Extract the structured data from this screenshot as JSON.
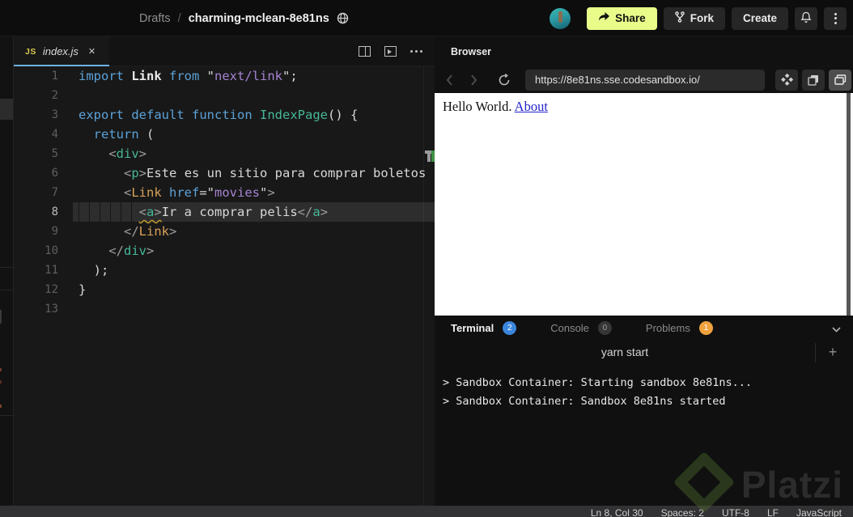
{
  "header": {
    "breadcrumb": {
      "section": "Drafts",
      "separator": "/",
      "project": "charming-mclean-8e81ns"
    },
    "share_label": "Share",
    "fork_label": "Fork",
    "create_label": "Create"
  },
  "colors": {
    "share_button": "#e9fc8a",
    "tab_underline": "#6fb2e2",
    "terminal_badge": "#3b86dd",
    "problems_badge": "#efa23d",
    "browser_link": "#2222cc",
    "keyword": "#5ca2d8",
    "string": "#a583d2",
    "tag": "#46b798",
    "component": "#d7a158"
  },
  "editor": {
    "tab": {
      "icon": "JS",
      "label": "index.js",
      "close": "✕"
    },
    "lines": [
      {
        "n": "1",
        "seg": [
          [
            "k",
            "import"
          ],
          [
            "w",
            " "
          ],
          [
            "b",
            "Link"
          ],
          [
            "w",
            " "
          ],
          [
            "k",
            "from"
          ],
          [
            "w",
            " \""
          ],
          [
            "s",
            "next/link"
          ],
          [
            "w",
            "\";"
          ]
        ]
      },
      {
        "n": "2",
        "seg": []
      },
      {
        "n": "3",
        "seg": [
          [
            "k",
            "export"
          ],
          [
            "w",
            " "
          ],
          [
            "k",
            "default"
          ],
          [
            "w",
            " "
          ],
          [
            "k",
            "function"
          ],
          [
            "w",
            " "
          ],
          [
            "t",
            "IndexPage"
          ],
          [
            "w",
            "() {"
          ]
        ]
      },
      {
        "n": "4",
        "seg": [
          [
            "w",
            "  "
          ],
          [
            "k",
            "return"
          ],
          [
            "w",
            " ("
          ]
        ]
      },
      {
        "n": "5",
        "seg": [
          [
            "w",
            "    "
          ],
          [
            "p",
            "<"
          ],
          [
            "t",
            "div"
          ],
          [
            "p",
            ">"
          ]
        ]
      },
      {
        "n": "6",
        "seg": [
          [
            "w",
            "      "
          ],
          [
            "p",
            "<"
          ],
          [
            "t",
            "p"
          ],
          [
            "p",
            ">"
          ],
          [
            "w",
            "Este es un sitio para comprar boletos"
          ]
        ]
      },
      {
        "n": "7",
        "seg": [
          [
            "w",
            "      "
          ],
          [
            "p",
            "<"
          ],
          [
            "c",
            "Link"
          ],
          [
            "w",
            " "
          ],
          [
            "a",
            "href"
          ],
          [
            "w",
            "=\""
          ],
          [
            "s",
            "movies"
          ],
          [
            "w",
            "\""
          ],
          [
            "p",
            ">"
          ]
        ]
      },
      {
        "n": "8",
        "hl": true,
        "seg": [
          [
            "w",
            "        "
          ],
          [
            "p sq",
            "<"
          ],
          [
            "t sq",
            "a"
          ],
          [
            "p sq",
            ">"
          ],
          [
            "w",
            "Ir a comprar pelis"
          ],
          [
            "p",
            "</"
          ],
          [
            "t",
            "a"
          ],
          [
            "p",
            ">"
          ]
        ]
      },
      {
        "n": "9",
        "seg": [
          [
            "w",
            "      "
          ],
          [
            "p",
            "</"
          ],
          [
            "c",
            "Link"
          ],
          [
            "p",
            ">"
          ]
        ]
      },
      {
        "n": "10",
        "seg": [
          [
            "w",
            "    "
          ],
          [
            "p",
            "</"
          ],
          [
            "t",
            "div"
          ],
          [
            "p",
            ">"
          ]
        ]
      },
      {
        "n": "11",
        "seg": [
          [
            "w",
            "  );"
          ]
        ]
      },
      {
        "n": "12",
        "seg": [
          [
            "w",
            "}"
          ]
        ]
      },
      {
        "n": "13",
        "seg": []
      }
    ]
  },
  "browser": {
    "title": "Browser",
    "url": "https://8e81ns.sse.codesandbox.io/",
    "content": {
      "text": "Hello World. ",
      "link": "About"
    }
  },
  "terminal": {
    "tabs": [
      {
        "label": "Terminal",
        "badge": "2"
      },
      {
        "label": "Console",
        "badge": "0"
      },
      {
        "label": "Problems",
        "badge": "1"
      }
    ],
    "session": "yarn start",
    "add_label": "+",
    "output": [
      "> Sandbox Container: Starting sandbox 8e81ns...",
      "> Sandbox Container: Sandbox 8e81ns started"
    ]
  },
  "statusbar": {
    "items": [
      "Ln 8, Col 30",
      "Spaces: 2",
      "UTF-8",
      "LF",
      "JavaScript"
    ]
  },
  "watermark": {
    "text": "Platzi"
  }
}
